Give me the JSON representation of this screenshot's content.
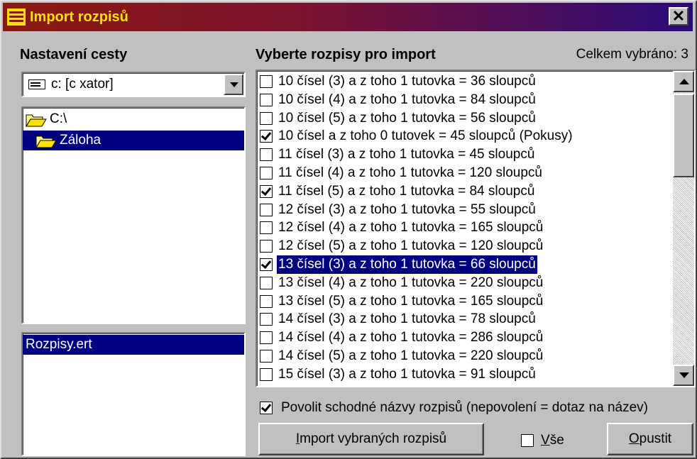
{
  "window": {
    "title": "Import rozpisů",
    "close_label": "✕"
  },
  "left": {
    "path_label": "Nastavení cesty",
    "drive": "c: [c xator]",
    "folders": [
      {
        "label": "C:\\",
        "selected": false,
        "open": true
      },
      {
        "label": "Záloha",
        "selected": true,
        "open": true
      }
    ],
    "files": [
      "Rozpisy.ert"
    ]
  },
  "right": {
    "select_label": "Vyberte rozpisy pro import",
    "count_label": "Celkem vybráno: 3",
    "items": [
      {
        "label": "10 čísel (3) a z toho 1 tutovka = 36 sloupců",
        "checked": false,
        "selected": false
      },
      {
        "label": "10 čísel (4) a z toho 1 tutovka = 84 sloupců",
        "checked": false,
        "selected": false
      },
      {
        "label": "10 čísel (5) a z toho 1 tutovka = 56 sloupců",
        "checked": false,
        "selected": false
      },
      {
        "label": "10 čísel a z toho 0 tutovek = 45 sloupců (Pokusy)",
        "checked": true,
        "selected": false
      },
      {
        "label": "11 čísel (3) a z toho 1 tutovka = 45 sloupců",
        "checked": false,
        "selected": false
      },
      {
        "label": "11 čísel (4) a z toho 1 tutovka = 120 sloupců",
        "checked": false,
        "selected": false
      },
      {
        "label": "11 čísel (5) a z toho 1 tutovka = 84 sloupců",
        "checked": true,
        "selected": false
      },
      {
        "label": "12 čísel (3) a z toho 1 tutovka = 55 sloupců",
        "checked": false,
        "selected": false
      },
      {
        "label": "12 čísel (4) a z toho 1 tutovka = 165 sloupců",
        "checked": false,
        "selected": false
      },
      {
        "label": "12 čísel (5) a z toho 1 tutovka = 120 sloupců",
        "checked": false,
        "selected": false
      },
      {
        "label": "13 čísel (3) a z toho 1 tutovka = 66 sloupců",
        "checked": true,
        "selected": true
      },
      {
        "label": "13 čísel (4) a z toho 1 tutovka = 220 sloupců",
        "checked": false,
        "selected": false
      },
      {
        "label": "13 čísel (5) a z toho 1 tutovka = 165 sloupců",
        "checked": false,
        "selected": false
      },
      {
        "label": "14 čísel (3) a z toho 1 tutovka = 78 sloupců",
        "checked": false,
        "selected": false
      },
      {
        "label": "14 čísel (4) a z toho 1 tutovka = 286 sloupců",
        "checked": false,
        "selected": false
      },
      {
        "label": "14 čísel (5) a z toho 1 tutovka = 220 sloupců",
        "checked": false,
        "selected": false
      },
      {
        "label": "15 čísel (3) a z toho 1 tutovka = 91 sloupců",
        "checked": false,
        "selected": false
      }
    ],
    "allow_option": {
      "label": "Povolit schodné názvy rozpisů (nepovolení = dotaz na název)",
      "checked": true
    }
  },
  "buttons": {
    "import_first": "I",
    "import_rest": "mport vybraných rozpisů",
    "all_first": "V",
    "all_rest": "še",
    "all_checked": false,
    "quit_first": "O",
    "quit_rest": "pustit"
  },
  "colors": {
    "selection": "#000080",
    "title_text": "#ffe000",
    "face": "#c0c0c0"
  }
}
